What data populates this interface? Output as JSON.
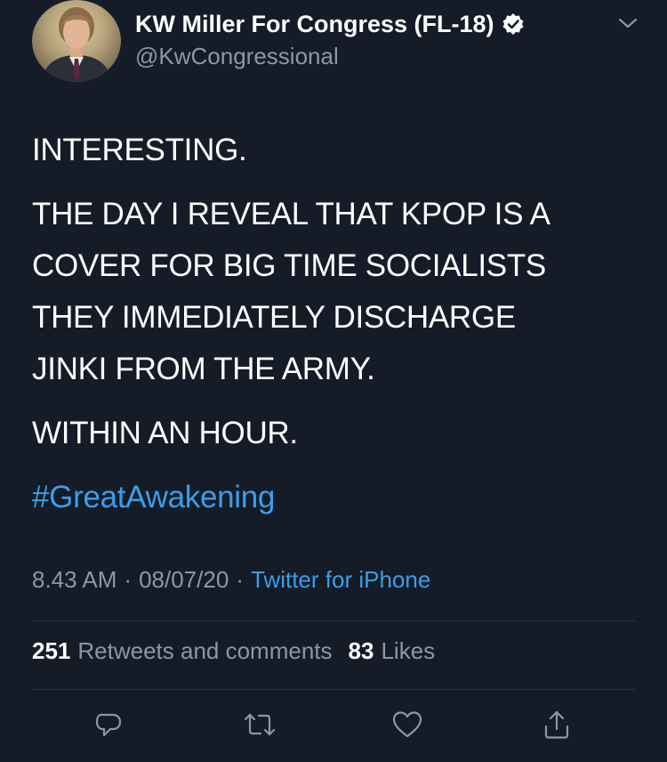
{
  "author": {
    "display_name": "KW Miller For Congress (FL-18)",
    "handle": "@KwCongressional",
    "verified_icon": "verified-badge-icon",
    "menu_icon": "chevron-down-icon"
  },
  "tweet": {
    "paragraphs": [
      "INTERESTING.",
      "THE DAY I REVEAL THAT KPOP IS A\nCOVER FOR BIG TIME SOCIALISTS\nTHEY IMMEDIATELY DISCHARGE\nJINKI FROM THE ARMY.",
      "WITHIN AN HOUR."
    ],
    "hashtag": "#GreatAwakening"
  },
  "meta": {
    "time": "8.43 AM",
    "separator": "·",
    "date": "08/07/20",
    "source": "Twitter for iPhone"
  },
  "stats": {
    "retweets_count": "251",
    "retweets_label": "Retweets and comments",
    "likes_count": "83",
    "likes_label": "Likes"
  },
  "actions": [
    "reply-icon",
    "retweet-icon",
    "like-icon",
    "share-icon"
  ],
  "colors": {
    "background": "#151c28",
    "text": "#ffffff",
    "secondary": "#8a98a6",
    "accent": "#3b9ee9",
    "divider": "#2a3340"
  }
}
